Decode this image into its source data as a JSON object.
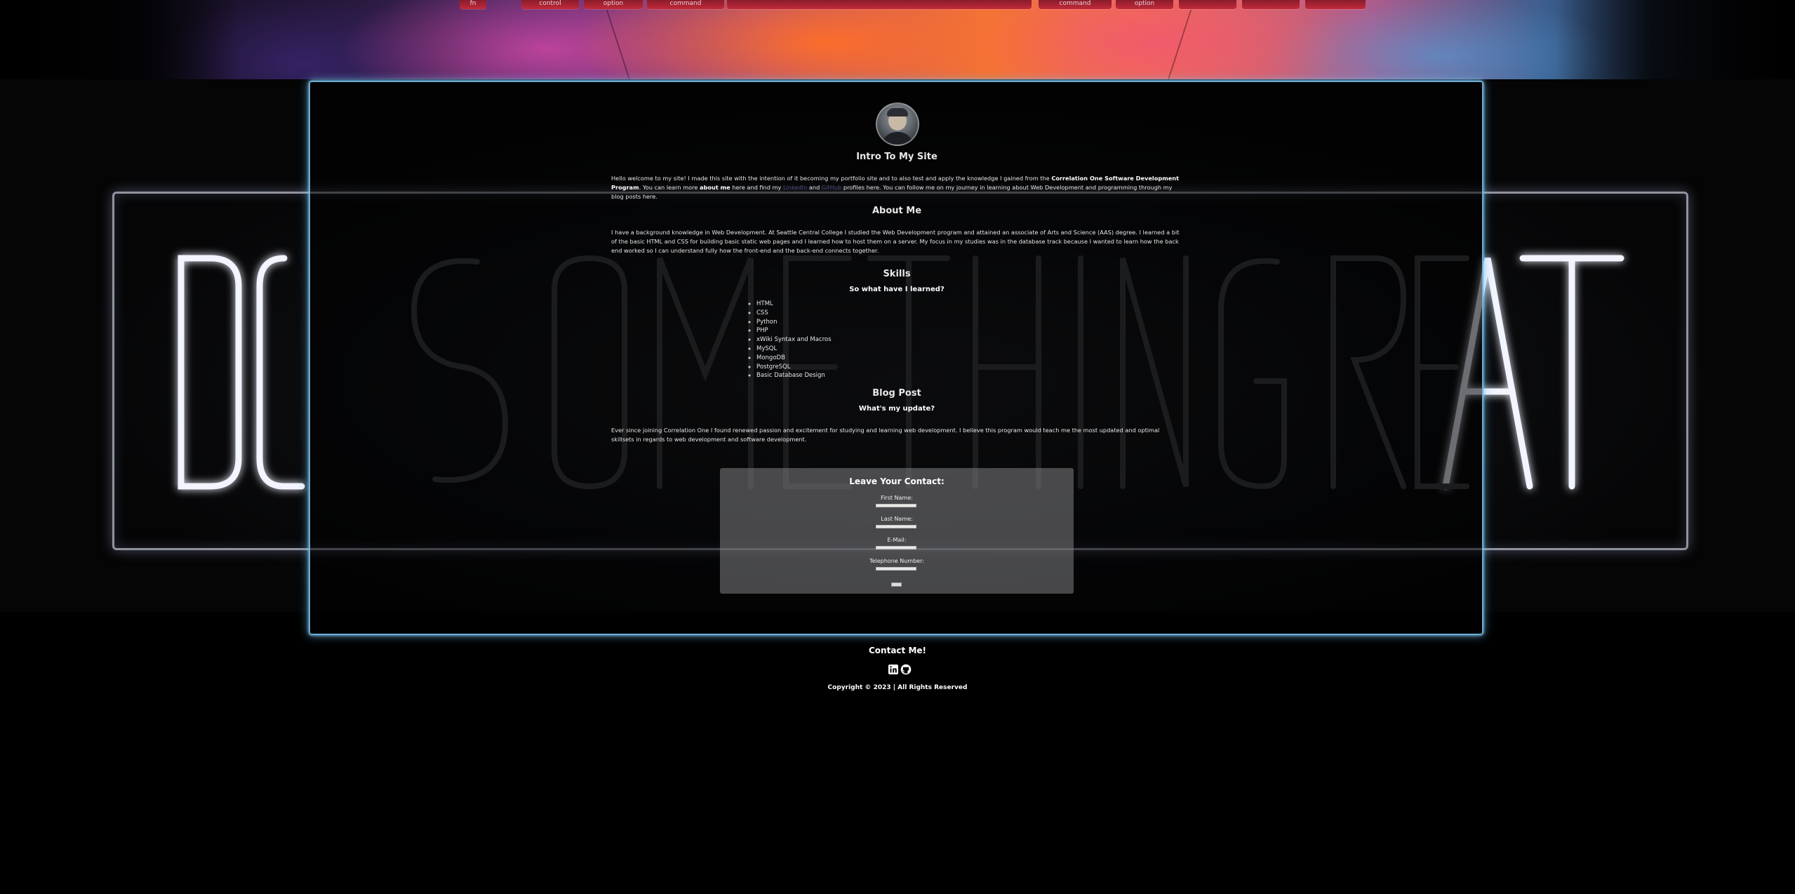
{
  "keyboard": {
    "keys": [
      "fn",
      "control",
      "option",
      "command",
      "command",
      "option"
    ]
  },
  "neon_sign": {
    "text": "DO SOMETHING GREAT"
  },
  "intro": {
    "title": "Intro To My Site",
    "text_1": "Hello welcome to my site! I made this site with the intention of it becoming my portfolio site and to also test and apply the knowledge I gained from the ",
    "program": "Correlation One Software Development Program",
    "text_2": ". You can learn more ",
    "about_link": "about me",
    "text_3": " here and find my ",
    "linkedin_link": "LinkedIn",
    "text_4": " and ",
    "github_link": "GitHub",
    "text_5": " profiles here. You can follow me on my journey in learning about Web Development and programming through my blog posts here."
  },
  "about": {
    "title": "About Me",
    "text": "I have a background knowledge in Web Development. At Seattle Central College I studied the Web Development program and attained an associate of Arts and Science (AAS) degree. I learned a bit of the basic HTML and CSS for building basic static web pages and I learned how to host them on a server. My focus in my studies was in the database track because I wanted to learn how the back end worked so I can understand fully how the front-end and the back-end connects together."
  },
  "skills": {
    "title": "Skills",
    "subtitle": "So what have I learned?",
    "items": [
      "HTML",
      "CSS",
      "Python",
      "PHP",
      "xWiki Syntax and Macros",
      "MySQL",
      "MongoDB",
      "PostgreSQL",
      "Basic Database Design"
    ]
  },
  "blog": {
    "title": "Blog Post",
    "subtitle": "What's my update?",
    "text": "Ever since joining Correlation One I found renewed passion and excitement for studying and learning web development. I believe this program would teach me the most updated and optimal skillsets in regards to web development and software development."
  },
  "contact_form": {
    "title": "Leave Your Contact:",
    "first_name_label": "First Name:",
    "last_name_label": "Last Name:",
    "email_label": "E-Mail:",
    "phone_label": "Telephone Number:"
  },
  "footer": {
    "title": "Contact Me!",
    "icons": [
      "linkedin-icon",
      "github-icon"
    ],
    "copyright": "Copyright © 2023 | All Rights Reserved"
  }
}
